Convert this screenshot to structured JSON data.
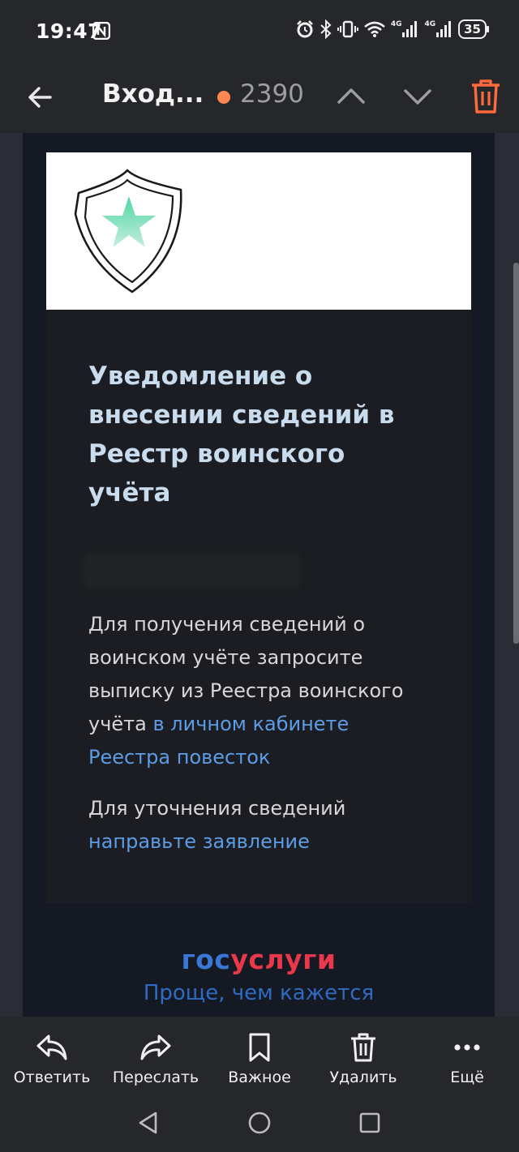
{
  "status_bar": {
    "time": "19:47",
    "network_labels": [
      "4G",
      "4G"
    ],
    "battery": "35"
  },
  "app_bar": {
    "folder_title": "Вход...",
    "unread_count": "2390",
    "unread_dot_color": "#ff8751",
    "trash_color": "#ff6a3d"
  },
  "email": {
    "title": "Уведомление о внесении сведений в Реестр воинского учёта",
    "paragraph_1_text": "Для получения сведений о воинском учёте запросите выписку из Реестра воинского учёта",
    "paragraph_1_link": "в личном кабинете Реестра повесток",
    "paragraph_2_text": "Для уточнения сведений",
    "paragraph_2_link": "направьте заявление",
    "brand_part_1": "гос",
    "brand_part_2": "услуги",
    "slogan": "Проще, чем кажется",
    "brand_colors": {
      "blue": "#3a78d6",
      "red": "#e9384a"
    }
  },
  "actions": [
    {
      "label": "Ответить",
      "icon": "reply-icon"
    },
    {
      "label": "Переслать",
      "icon": "forward-icon"
    },
    {
      "label": "Важное",
      "icon": "bookmark-icon"
    },
    {
      "label": "Удалить",
      "icon": "trash-icon"
    },
    {
      "label": "Ещё",
      "icon": "more-icon"
    }
  ],
  "system_nav": [
    "back-triangle-icon",
    "home-circle-icon",
    "recents-square-icon"
  ]
}
